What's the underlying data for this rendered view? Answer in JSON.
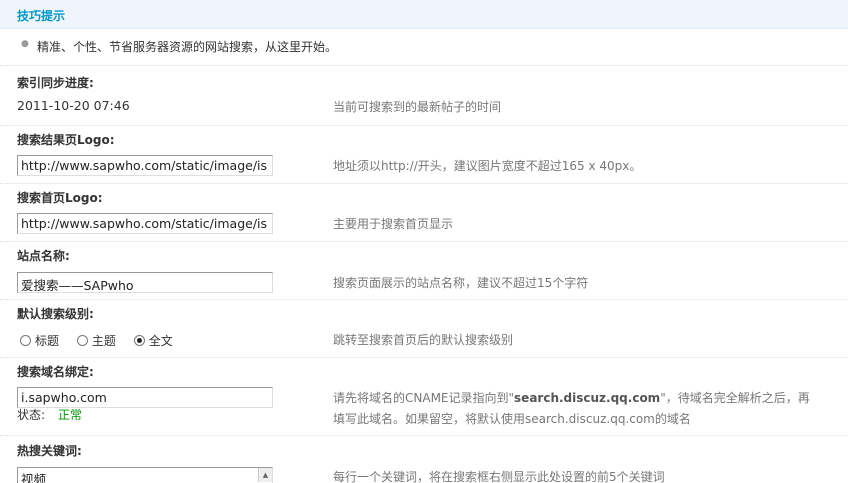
{
  "tips": {
    "title": "技巧提示",
    "items": [
      "精准、个性、节省服务器资源的网站搜索，从这里开始。"
    ]
  },
  "index_sync": {
    "label": "索引同步进度:",
    "value": "2011-10-20 07:46",
    "hint": "当前可搜索到的最新帖子的时间"
  },
  "result_logo": {
    "label": "搜索结果页Logo:",
    "value": "http://www.sapwho.com/static/image/is",
    "hint": "地址须以http://开头，建议图片宽度不超过165 x 40px。"
  },
  "home_logo": {
    "label": "搜索首页Logo:",
    "value": "http://www.sapwho.com/static/image/is",
    "hint": "主要用于搜索首页显示"
  },
  "site_name": {
    "label": "站点名称:",
    "value": "爱搜索——SAPwho",
    "hint": "搜索页面展示的站点名称，建议不超过15个字符"
  },
  "search_level": {
    "label": "默认搜索级别:",
    "options": [
      "标题",
      "主题",
      "全文"
    ],
    "selected": "全文",
    "hint": "跳转至搜索首页后的默认搜索级别"
  },
  "domain_bind": {
    "label": "搜索域名绑定:",
    "value": "i.sapwho.com",
    "status_label": "状态:",
    "status_value": "正常",
    "status_color": "#009900",
    "hint_part1": "请先将域名的CNAME记录指向到\"",
    "hint_bold": "search.discuz.qq.com",
    "hint_part2": "\"，待域名完全解析之后，再",
    "hint_line2": "填写此域名。如果留空，将默认使用search.discuz.qq.com的域名"
  },
  "hot_keywords": {
    "label": "热搜关键词:",
    "value": "视频",
    "hint": "每行一个关键词，将在搜索框右侧显示此处设置的前5个关键词"
  },
  "colors": {
    "accent": "#0099cc",
    "header_bg": "#f0f5fb"
  }
}
